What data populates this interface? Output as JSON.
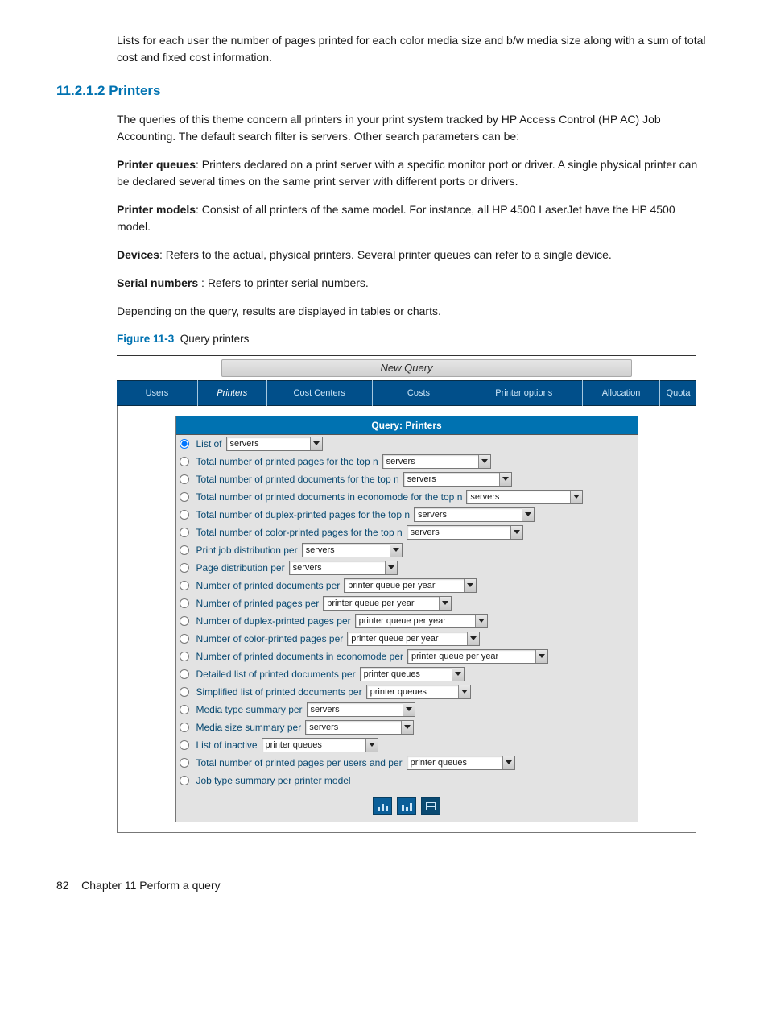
{
  "intro_para": "Lists for each user the number of pages printed for each color media size and b/w media size along with a sum of total cost and fixed cost information.",
  "section_number": "11.2.1.2 Printers",
  "para1": "The queries of this theme concern all printers in your print system tracked by HP Access Control (HP AC) Job Accounting. The default search filter is servers. Other search parameters can be:",
  "def_printer_queues_label": "Printer queues",
  "def_printer_queues_text": ": Printers declared on a print server with a specific monitor port or driver. A single physical printer can be declared several times on the same print server with different ports or drivers.",
  "def_printer_models_label": "Printer models",
  "def_printer_models_text": ": Consist of all printers of the same model. For instance, all HP 4500 LaserJet have the HP 4500 model.",
  "def_devices_label": "Devices",
  "def_devices_text": ": Refers to the actual, physical printers. Several printer queues can refer to a single device.",
  "def_serial_label": "Serial numbers",
  "def_serial_text": " : Refers to printer serial numbers.",
  "para_depending": "Depending on the query, results are displayed in tables or charts.",
  "figure_label": "Figure 11-3",
  "figure_title": "Query printers",
  "new_query_label": "New Query",
  "tabs": {
    "users": "Users",
    "printers": "Printers",
    "cost_centers": "Cost Centers",
    "costs": "Costs",
    "printer_options": "Printer options",
    "allocation": "Allocation",
    "quota": "Quota"
  },
  "panel_title": "Query: Printers",
  "select_values": {
    "servers": "servers",
    "pq_year": "printer queue per year",
    "pq": "printer queues"
  },
  "rows": {
    "r1": "List of",
    "r2": "Total number of printed pages for the top n",
    "r3": "Total number of printed documents for the top n",
    "r4": "Total number of printed documents in economode for the top n",
    "r5": "Total number of duplex-printed pages for the top n",
    "r6": "Total number of color-printed pages for the top n",
    "r7": "Print job distribution per",
    "r8": "Page distribution per",
    "r9": "Number of printed documents per",
    "r10": "Number of printed pages per",
    "r11": "Number of duplex-printed pages per",
    "r12": "Number of color-printed pages per",
    "r13": "Number of printed documents in economode per",
    "r14": "Detailed list of printed documents per",
    "r15": "Simplified list of printed documents per",
    "r16": "Media type summary per",
    "r17": "Media size summary per",
    "r18": "List of inactive",
    "r19": "Total number of printed pages per users and per",
    "r20": "Job type summary per printer model"
  },
  "footer": {
    "page_num": "82",
    "chapter": "Chapter 11   Perform a query"
  }
}
